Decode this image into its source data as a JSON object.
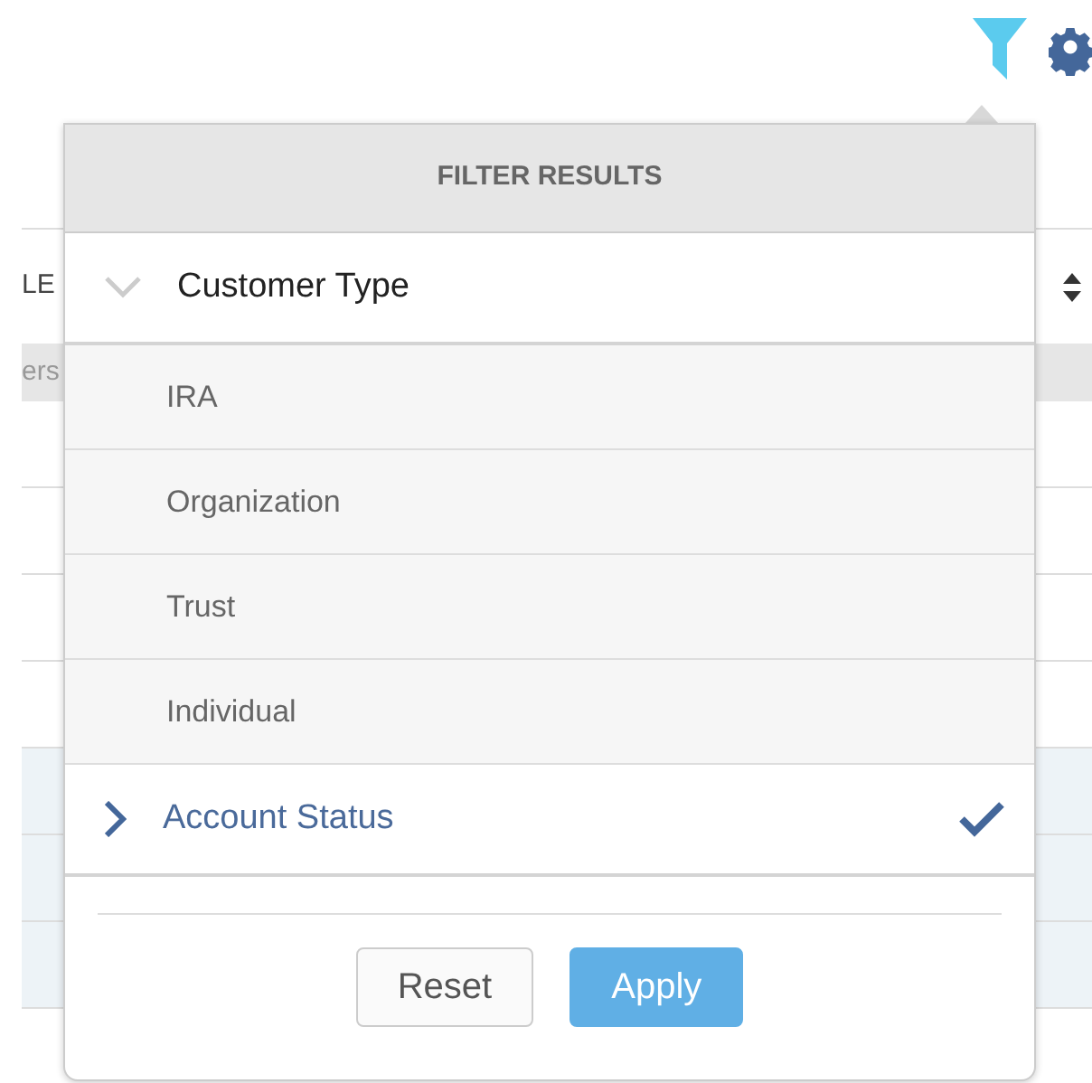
{
  "toolbar": {
    "filter_active": true
  },
  "background_table": {
    "header_fragment": "LE",
    "row_fragment": "ers",
    "rows": [
      {
        "highlighted": false
      },
      {
        "highlighted": false
      },
      {
        "highlighted": false
      },
      {
        "highlighted": false
      },
      {
        "highlighted": true
      },
      {
        "highlighted": true
      },
      {
        "highlighted": true
      }
    ]
  },
  "filter_panel": {
    "title": "FILTER RESULTS",
    "sections": [
      {
        "label": "Customer Type",
        "expanded": true,
        "checked": false,
        "options": [
          "IRA",
          "Organization",
          "Trust",
          "Individual"
        ]
      },
      {
        "label": "Account Status",
        "expanded": false,
        "checked": true
      }
    ],
    "buttons": [
      {
        "label": "Reset",
        "kind": "secondary"
      },
      {
        "label": "Apply",
        "kind": "primary"
      }
    ]
  }
}
